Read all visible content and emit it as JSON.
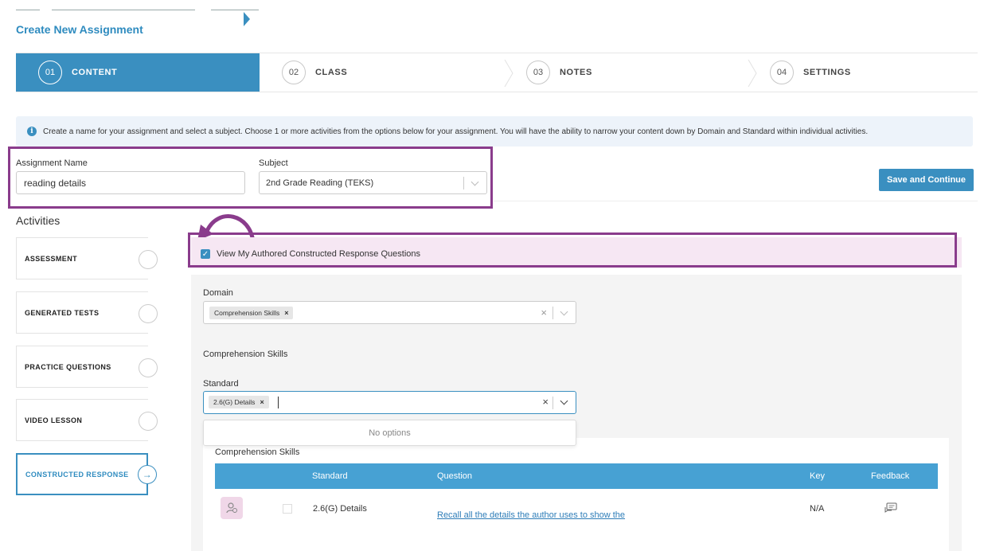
{
  "header": {
    "title": "Create New Assignment"
  },
  "stepper": {
    "steps": [
      {
        "num": "01",
        "label": "CONTENT"
      },
      {
        "num": "02",
        "label": "CLASS"
      },
      {
        "num": "03",
        "label": "NOTES"
      },
      {
        "num": "04",
        "label": "SETTINGS"
      }
    ]
  },
  "info": {
    "text": "Create a name for your assignment and select a subject. Choose 1 or more activities from the options below for your assignment. You will have the ability to narrow your content down by Domain and Standard within individual activities."
  },
  "form": {
    "name_label": "Assignment Name",
    "name_value": "reading details",
    "subject_label": "Subject",
    "subject_value": "2nd Grade Reading (TEKS)",
    "save_label": "Save and Continue"
  },
  "activities": {
    "title": "Activities",
    "items": [
      {
        "label": "ASSESSMENT"
      },
      {
        "label": "GENERATED TESTS"
      },
      {
        "label": "PRACTICE QUESTIONS"
      },
      {
        "label": "VIDEO LESSON"
      },
      {
        "label": "CONSTRUCTED RESPONSE"
      }
    ]
  },
  "constructed": {
    "checkbox_label": "View My Authored Constructed Response Questions",
    "domain_label": "Domain",
    "domain_chip": "Comprehension Skills",
    "section_title": "Comprehension Skills",
    "standard_label": "Standard",
    "standard_chip": "2.6(G) Details",
    "no_options": "No options"
  },
  "table": {
    "group_title": "Comprehension Skills",
    "headers": {
      "standard": "Standard",
      "question": "Question",
      "key": "Key",
      "feedback": "Feedback"
    },
    "rows": [
      {
        "standard": "2.6(G) Details",
        "question": "Recall all the details the author uses to show the",
        "key": "N/A"
      }
    ]
  },
  "colors": {
    "accent": "#3a8fc0",
    "highlight": "#8a3c8c",
    "highlight_bg": "#f6e7f3"
  }
}
